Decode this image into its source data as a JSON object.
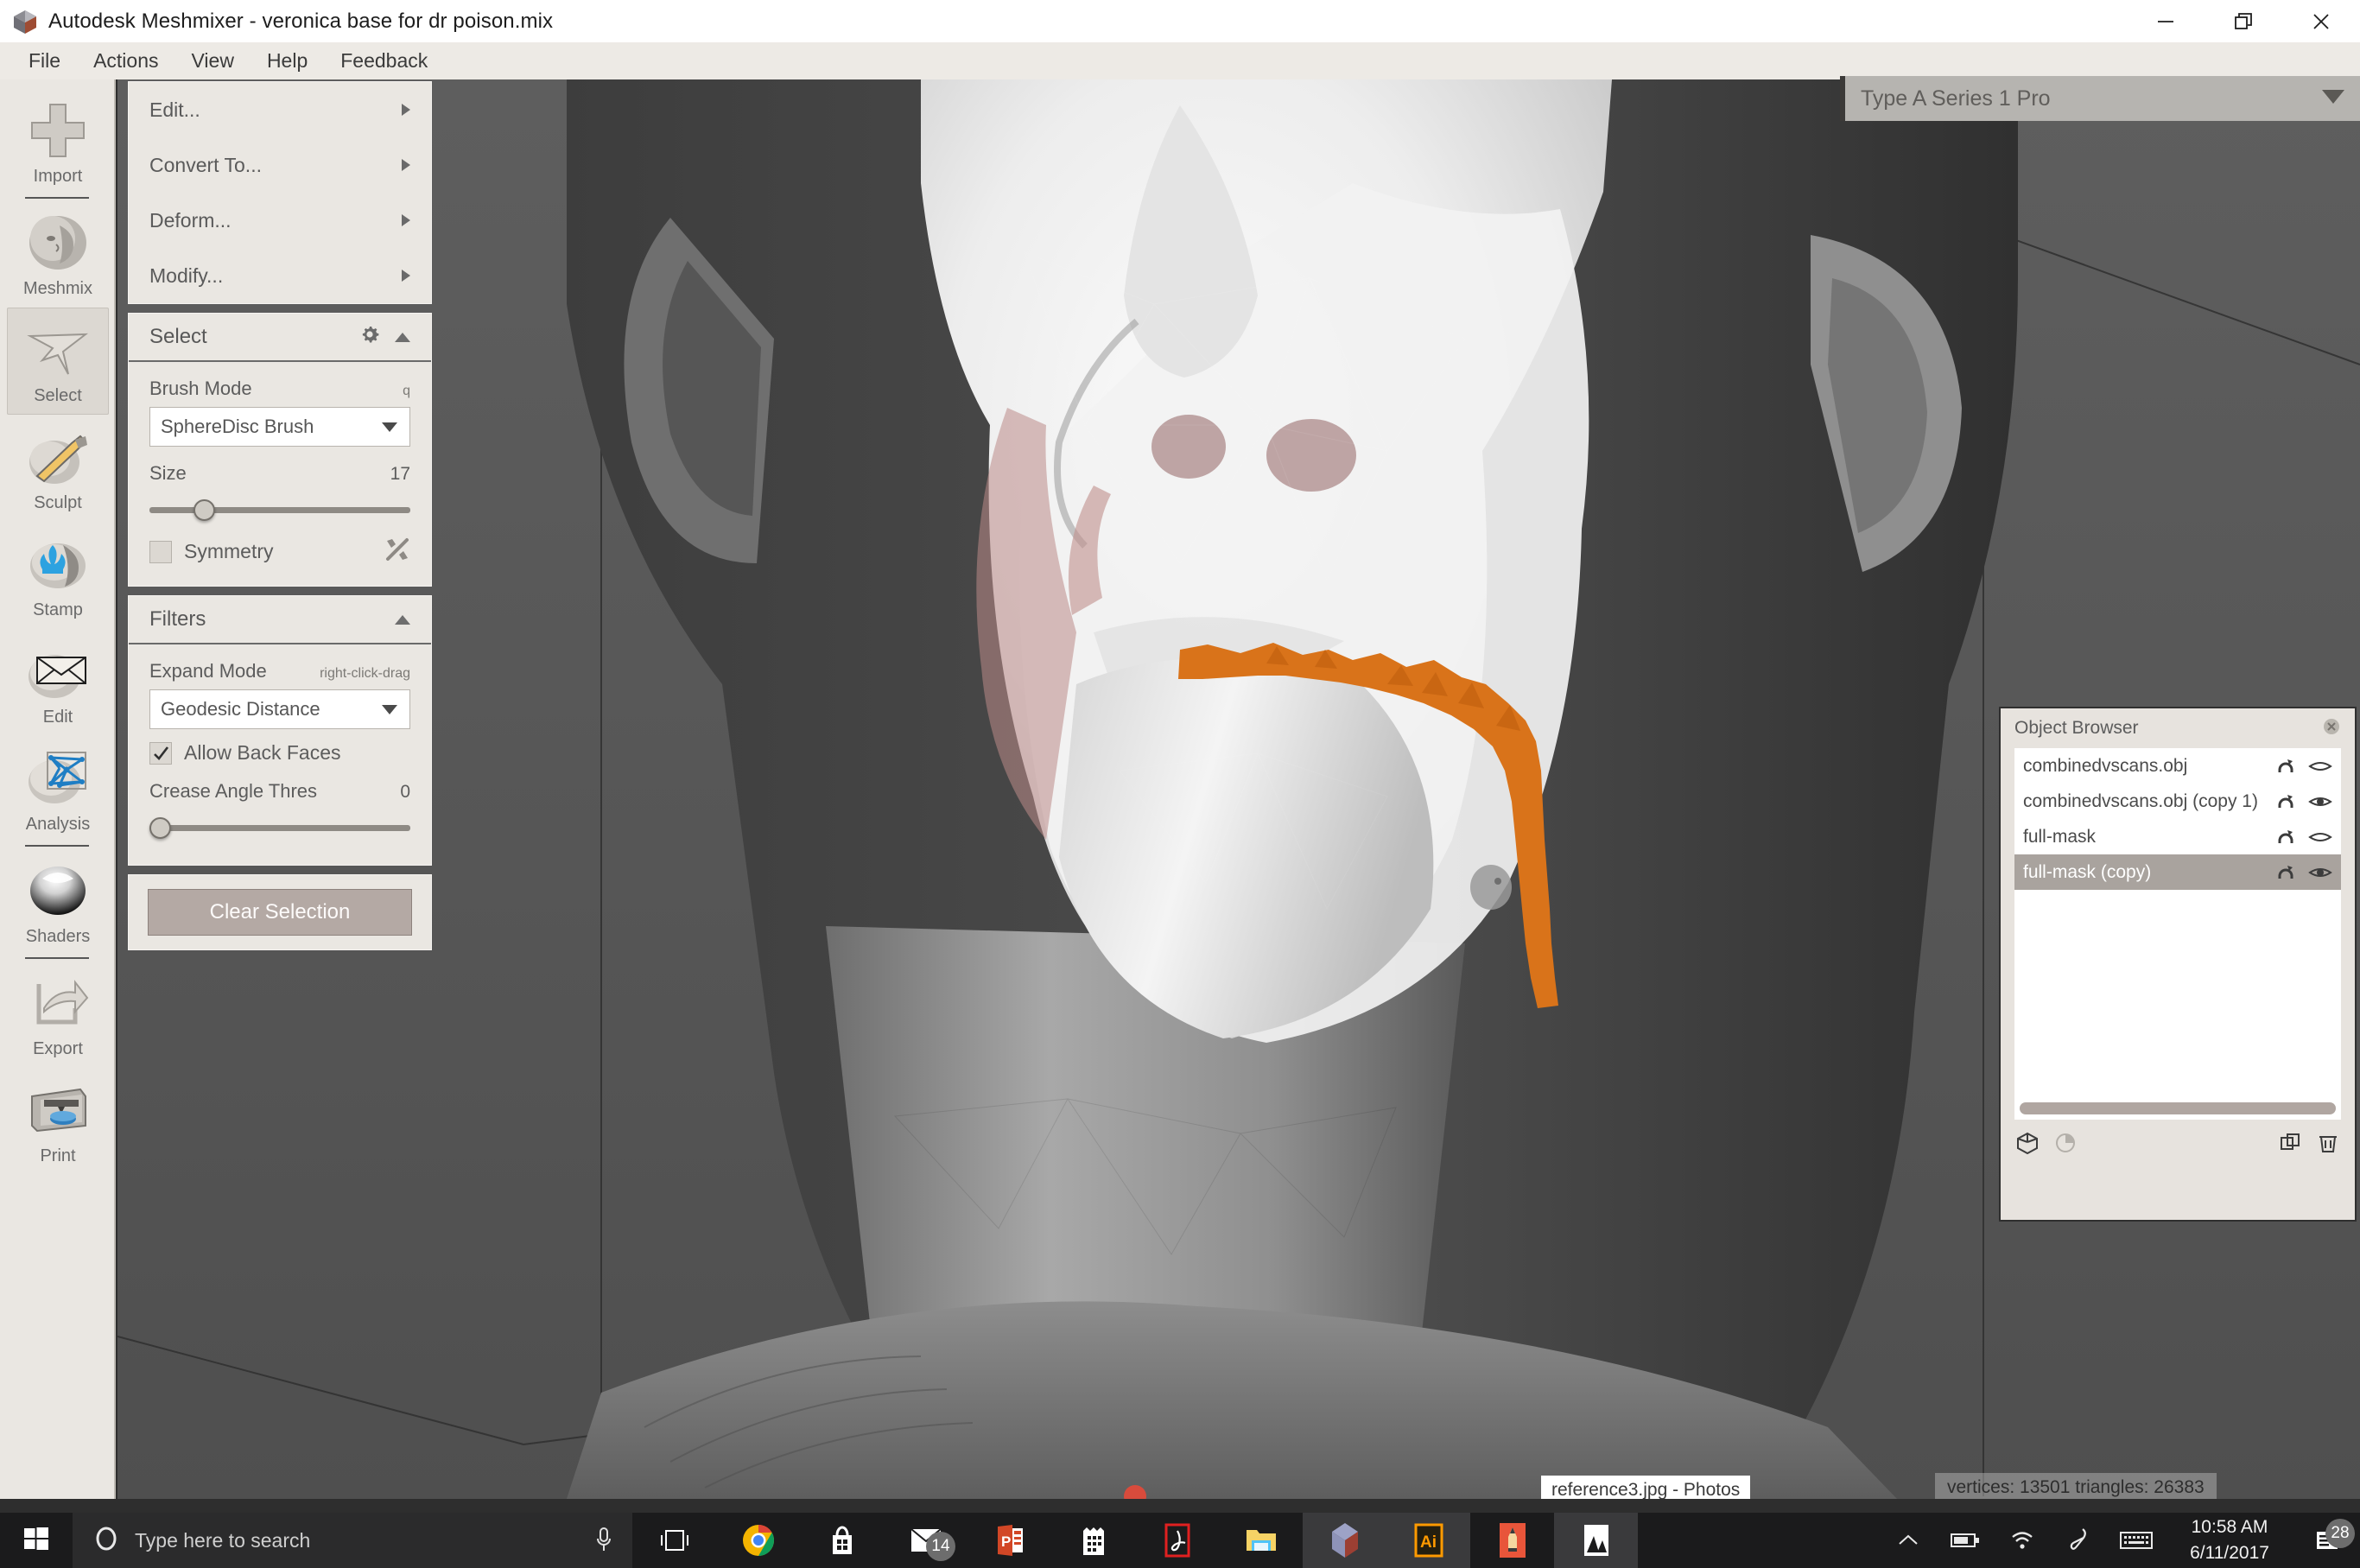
{
  "window": {
    "title": "Autodesk Meshmixer - veronica base for dr poison.mix",
    "logo_icon": "meshmixer-logo-icon",
    "controls": [
      {
        "name": "minimize-button",
        "icon": "minimize-icon"
      },
      {
        "name": "restore-button",
        "icon": "restore-icon"
      },
      {
        "name": "close-button",
        "icon": "close-icon"
      }
    ]
  },
  "menubar": {
    "items": [
      "File",
      "Actions",
      "View",
      "Help",
      "Feedback"
    ]
  },
  "toolrail": {
    "items": [
      {
        "label": "Import",
        "icon": "plus-icon",
        "selected": false
      },
      {
        "label": "Meshmix",
        "icon": "face-sphere-icon",
        "selected": false
      },
      {
        "label": "Select",
        "icon": "cursor-arrow-icon",
        "selected": true
      },
      {
        "label": "Sculpt",
        "icon": "brush-sphere-icon",
        "selected": false
      },
      {
        "label": "Stamp",
        "icon": "stamp-fleur-icon",
        "selected": false
      },
      {
        "label": "Edit",
        "icon": "envelope-sphere-icon",
        "selected": false
      },
      {
        "label": "Analysis",
        "icon": "mesh-wireframe-icon",
        "selected": false
      },
      {
        "label": "Shaders",
        "icon": "glossy-sphere-icon",
        "selected": false
      },
      {
        "label": "Export",
        "icon": "export-arrow-icon",
        "selected": false
      },
      {
        "label": "Print",
        "icon": "3d-printer-icon",
        "selected": false
      }
    ]
  },
  "command_menu": {
    "items": [
      {
        "label": "Edit...",
        "icon": "chevron-right-icon"
      },
      {
        "label": "Convert To...",
        "icon": "chevron-right-icon"
      },
      {
        "label": "Deform...",
        "icon": "chevron-right-icon"
      },
      {
        "label": "Modify...",
        "icon": "chevron-right-icon"
      }
    ]
  },
  "select_panel": {
    "title": "Select",
    "gear_icon": "gear-icon",
    "collapse_icon": "caret-up-icon",
    "brush_mode": {
      "label": "Brush Mode",
      "hint": "q",
      "value": "SphereDisc Brush",
      "caret_icon": "caret-down-icon"
    },
    "size": {
      "label": "Size",
      "value": "17",
      "percent": 17
    },
    "symmetry": {
      "label": "Symmetry",
      "checked": false,
      "tool_icon": "wrench-screwdriver-icon"
    }
  },
  "filters_panel": {
    "title": "Filters",
    "collapse_icon": "caret-up-icon",
    "expand_mode": {
      "label": "Expand Mode",
      "hint": "right-click-drag",
      "value": "Geodesic Distance",
      "caret_icon": "caret-down-icon"
    },
    "allow_back_faces": {
      "label": "Allow Back Faces",
      "checked": true,
      "check_icon": "check-icon"
    },
    "crease_angle": {
      "label": "Crease Angle Thres",
      "value": "0",
      "percent": 0
    }
  },
  "actions_panel": {
    "clear_selection_label": "Clear Selection"
  },
  "printer_selector": {
    "value": "Type A Series 1 Pro",
    "caret_icon": "caret-down-icon"
  },
  "object_browser": {
    "title": "Object Browser",
    "close_icon": "circle-x-icon",
    "rows": [
      {
        "name": "combinedvscans.obj",
        "selected": false,
        "pin_icon": "magnet-icon",
        "visibility_icon": "eye-closed-icon",
        "visible": false
      },
      {
        "name": "combinedvscans.obj (copy 1)",
        "selected": false,
        "pin_icon": "magnet-icon",
        "visibility_icon": "eye-open-icon",
        "visible": true
      },
      {
        "name": "full-mask",
        "selected": false,
        "pin_icon": "magnet-icon",
        "visibility_icon": "eye-closed-icon",
        "visible": false
      },
      {
        "name": "full-mask (copy)",
        "selected": true,
        "pin_icon": "magnet-icon",
        "visibility_icon": "eye-open-icon",
        "visible": true
      }
    ],
    "footer_icons": [
      {
        "name": "cube-icon"
      },
      {
        "name": "pie-clock-icon"
      },
      {
        "name": "duplicate-icon"
      },
      {
        "name": "trash-icon"
      }
    ],
    "scrollbar": "horizontal-scrollbar"
  },
  "viewport": {
    "status_vertices": "vertices: 13501 triangles: 26383",
    "selection_color": "#d9731a",
    "background_color": "#585858"
  },
  "taskbar_overlay": {
    "window_tooltip": "reference3.jpg - Photos"
  },
  "taskbar": {
    "start_icon": "windows-logo-icon",
    "search_placeholder": "Type here to search",
    "cortana_icon": "cortana-circle-icon",
    "mic_icon": "microphone-icon",
    "apps": [
      {
        "name": "task-view-icon",
        "active": false
      },
      {
        "name": "chrome-icon",
        "active": false
      },
      {
        "name": "microsoft-store-icon",
        "active": false
      },
      {
        "name": "mail-icon",
        "active": false,
        "badge": "14"
      },
      {
        "name": "powerpoint-icon",
        "active": false
      },
      {
        "name": "calendar-icon",
        "active": false
      },
      {
        "name": "acrobat-reader-icon",
        "active": false
      },
      {
        "name": "file-explorer-icon",
        "active": false
      },
      {
        "name": "meshmixer-icon",
        "active": true
      },
      {
        "name": "illustrator-icon",
        "active": true
      },
      {
        "name": "sketch-pencil-icon",
        "active": false
      },
      {
        "name": "photos-icon",
        "active": true
      }
    ],
    "tray": [
      {
        "name": "show-hidden-icons-chevron-icon"
      },
      {
        "name": "battery-icon"
      },
      {
        "name": "wifi-icon"
      },
      {
        "name": "pen-icon"
      },
      {
        "name": "touch-keyboard-icon"
      }
    ],
    "clock_time": "10:58 AM",
    "clock_date": "6/11/2017",
    "notification_icon": "action-center-icon",
    "notification_count": "28"
  }
}
